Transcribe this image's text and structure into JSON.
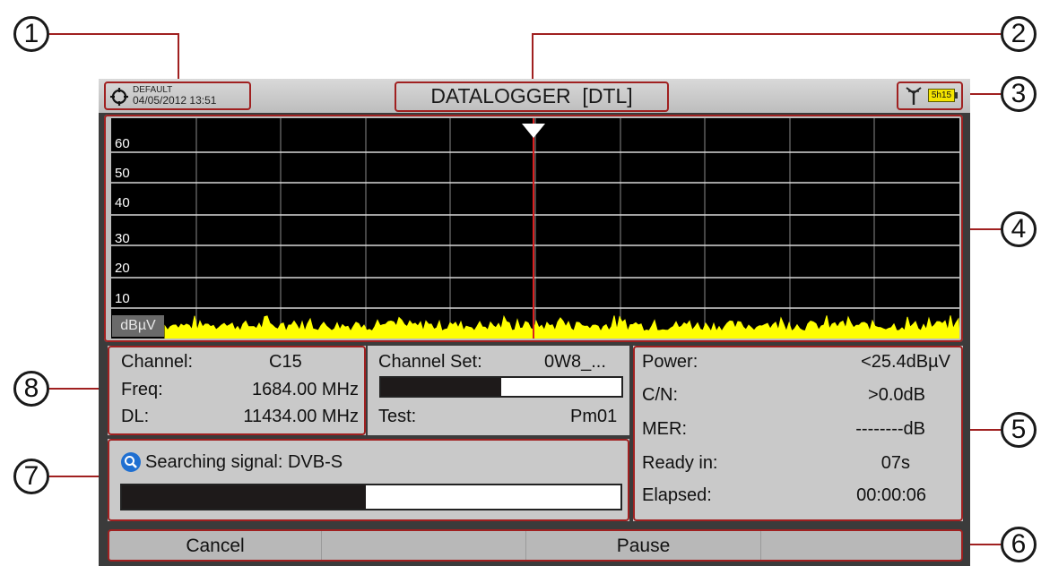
{
  "header": {
    "profile": "DEFAULT",
    "datetime": "04/05/2012 13:51",
    "title": "DATALOGGER  [DTL]",
    "battery": "5h15"
  },
  "graph": {
    "unit": "dBµV",
    "y_ticks": [
      "60",
      "50",
      "40",
      "30",
      "20",
      "10"
    ]
  },
  "channel_info": {
    "channel_label": "Channel:",
    "channel_value": "C15",
    "freq_label": "Freq:",
    "freq_value": "1684.00 MHz",
    "dl_label": "DL:",
    "dl_value": "11434.00 MHz"
  },
  "channel_set": {
    "label": "Channel Set:",
    "value": "0W8_...",
    "progress": 0.5,
    "test_label": "Test:",
    "test_value": "Pm01"
  },
  "search": {
    "status": "Searching signal: DVB-S",
    "progress": 0.49
  },
  "measures": {
    "power_label": "Power:",
    "power_value": "<25.4dBµV",
    "cn_label": "C/N:",
    "cn_value": ">0.0dB",
    "mer_label": "MER:",
    "mer_value": "--------dB",
    "ready_label": "Ready in:",
    "ready_value": "07s",
    "elapsed_label": "Elapsed:",
    "elapsed_value": "00:00:06"
  },
  "softkeys": {
    "cancel": "Cancel",
    "empty1": "",
    "pause": "Pause",
    "empty2": ""
  },
  "callouts": [
    "1",
    "2",
    "3",
    "4",
    "5",
    "6",
    "7",
    "8"
  ],
  "colors": {
    "highlight": "#a02020",
    "spectrum": "#ffff00",
    "marker": "#d92020",
    "panel": "#c9c9c9",
    "battery": "#f4e400"
  }
}
